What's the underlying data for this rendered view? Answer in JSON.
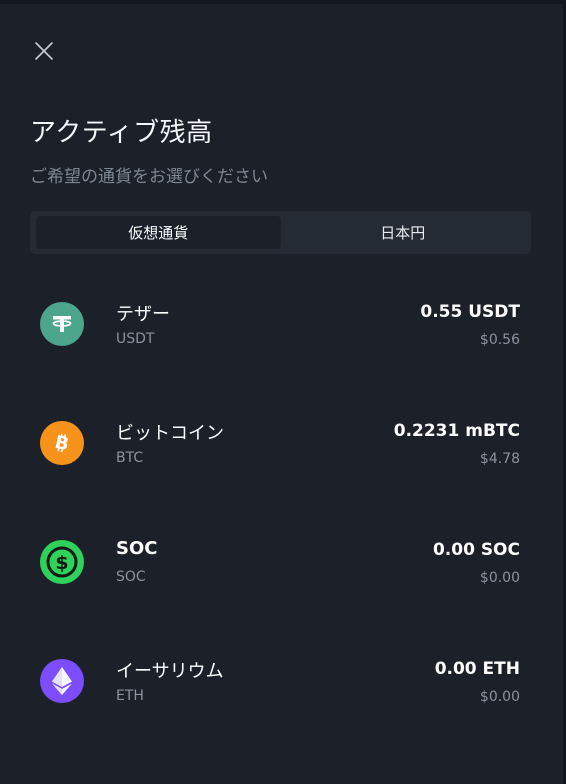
{
  "header": {
    "close_icon": "close-icon",
    "title": "アクティブ残高",
    "subtitle": "ご希望の通貨をお選びください"
  },
  "tabs": [
    {
      "label": "仮想通貨",
      "active": true
    },
    {
      "label": "日本円",
      "active": false
    }
  ],
  "coins": [
    {
      "name": "テザー",
      "symbol": "USDT",
      "amount": "0.55 USDT",
      "fiat": "$0.56",
      "icon": "tether-icon",
      "color": "#4da58b"
    },
    {
      "name": "ビットコイン",
      "symbol": "BTC",
      "amount": "0.2231 mBTC",
      "fiat": "$4.78",
      "icon": "bitcoin-icon",
      "color": "#f7931a"
    },
    {
      "name": "SOC",
      "symbol": "SOC",
      "amount": "0.00 SOC",
      "fiat": "$0.00",
      "icon": "soc-icon",
      "color": "#2ed15a"
    },
    {
      "name": "イーサリウム",
      "symbol": "ETH",
      "amount": "0.00 ETH",
      "fiat": "$0.00",
      "icon": "ethereum-icon",
      "color": "#7b4dff"
    }
  ]
}
